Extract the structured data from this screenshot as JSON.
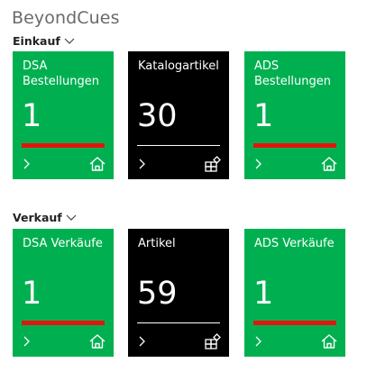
{
  "page": {
    "title": "BeyondCues"
  },
  "groups": [
    {
      "title": "Einkauf",
      "tiles": [
        {
          "label": "DSA\nBestellungen",
          "value": "1",
          "style": "green",
          "icon": "home-icon"
        },
        {
          "label": "Katalogartikel",
          "value": "30",
          "style": "black",
          "icon": "catalog-icon"
        },
        {
          "label": "ADS\nBestellungen",
          "value": "1",
          "style": "green",
          "icon": "home-icon"
        }
      ]
    },
    {
      "title": "Verkauf",
      "tiles": [
        {
          "label": "DSA Verkäufe",
          "value": "1",
          "style": "green",
          "icon": "home-icon"
        },
        {
          "label": "Artikel",
          "value": "59",
          "style": "black",
          "icon": "catalog-icon"
        },
        {
          "label": "ADS Verkäufe",
          "value": "1",
          "style": "green",
          "icon": "home-icon"
        }
      ]
    }
  ],
  "colors": {
    "green_tile": "#00b050",
    "black_tile": "#000000",
    "indicator_bar": "#e3140c",
    "title_text": "#6a6a6a"
  }
}
